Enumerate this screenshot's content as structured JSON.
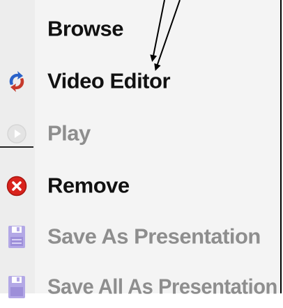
{
  "menu": {
    "items": [
      {
        "label": "Browse",
        "enabled": true,
        "icon": "none"
      },
      {
        "label": "Video Editor",
        "enabled": true,
        "icon": "video-editor-icon"
      },
      {
        "label": "Play",
        "enabled": false,
        "icon": "play-icon"
      },
      {
        "label": "Remove",
        "enabled": true,
        "icon": "remove-icon"
      },
      {
        "label": "Save As Presentation",
        "enabled": false,
        "icon": "save-icon"
      },
      {
        "label": "Save All As Presentation",
        "enabled": false,
        "icon": "save-all-icon"
      }
    ]
  },
  "colors": {
    "enabled_text": "#111111",
    "disabled_text": "#8e8e8e",
    "remove_red": "#d9231d",
    "save_purple": "#9d8fd9"
  }
}
